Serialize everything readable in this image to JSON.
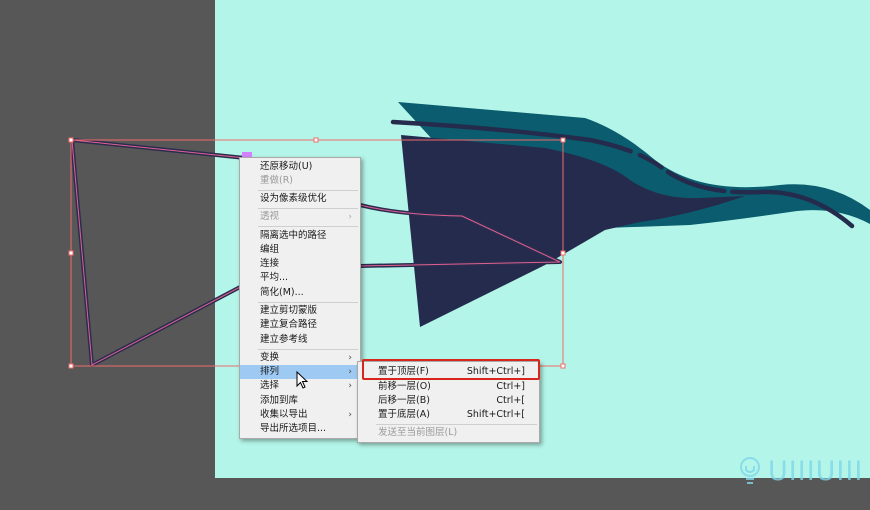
{
  "context_menu": {
    "items": [
      {
        "label": "还原移动(U)",
        "disabled": false,
        "submenu": false
      },
      {
        "label": "重做(R)",
        "disabled": true,
        "submenu": false
      },
      {
        "label": "设为像素级优化",
        "disabled": false,
        "submenu": false
      },
      {
        "label": "透视",
        "disabled": true,
        "submenu": true
      },
      {
        "label": "隔离选中的路径",
        "disabled": false,
        "submenu": false
      },
      {
        "label": "编组",
        "disabled": false,
        "submenu": false
      },
      {
        "label": "连接",
        "disabled": false,
        "submenu": false
      },
      {
        "label": "平均...",
        "disabled": false,
        "submenu": false
      },
      {
        "label": "简化(M)...",
        "disabled": false,
        "submenu": false
      },
      {
        "label": "建立剪切蒙版",
        "disabled": false,
        "submenu": false
      },
      {
        "label": "建立复合路径",
        "disabled": false,
        "submenu": false
      },
      {
        "label": "建立参考线",
        "disabled": false,
        "submenu": false
      },
      {
        "label": "变换",
        "disabled": false,
        "submenu": true
      },
      {
        "label": "排列",
        "disabled": false,
        "submenu": true,
        "highlighted": true
      },
      {
        "label": "选择",
        "disabled": false,
        "submenu": true
      },
      {
        "label": "添加到库",
        "disabled": false,
        "submenu": false
      },
      {
        "label": "收集以导出",
        "disabled": false,
        "submenu": true
      },
      {
        "label": "导出所选项目...",
        "disabled": false,
        "submenu": false
      }
    ]
  },
  "arrange_submenu": {
    "items": [
      {
        "label": "置于顶层(F)",
        "shortcut": "Shift+Ctrl+]",
        "disabled": false
      },
      {
        "label": "前移一层(O)",
        "shortcut": "Ctrl+]",
        "disabled": false
      },
      {
        "label": "后移一层(B)",
        "shortcut": "Ctrl+[",
        "disabled": false
      },
      {
        "label": "置于底层(A)",
        "shortcut": "Shift+Ctrl+[",
        "disabled": false
      },
      {
        "label": "发送至当前图层(L)",
        "shortcut": "",
        "disabled": true
      }
    ]
  },
  "watermark": {
    "text": "UIIIUIII"
  },
  "colors": {
    "pasteboard": "#575757",
    "artboard": "#b3f5e8",
    "teal_shape": "#0a5c6e",
    "navy_shape": "#252b4d",
    "selection": "#f06b6b",
    "highlight_box": "#d9261c",
    "menu_highlight": "#9ec9f2"
  }
}
